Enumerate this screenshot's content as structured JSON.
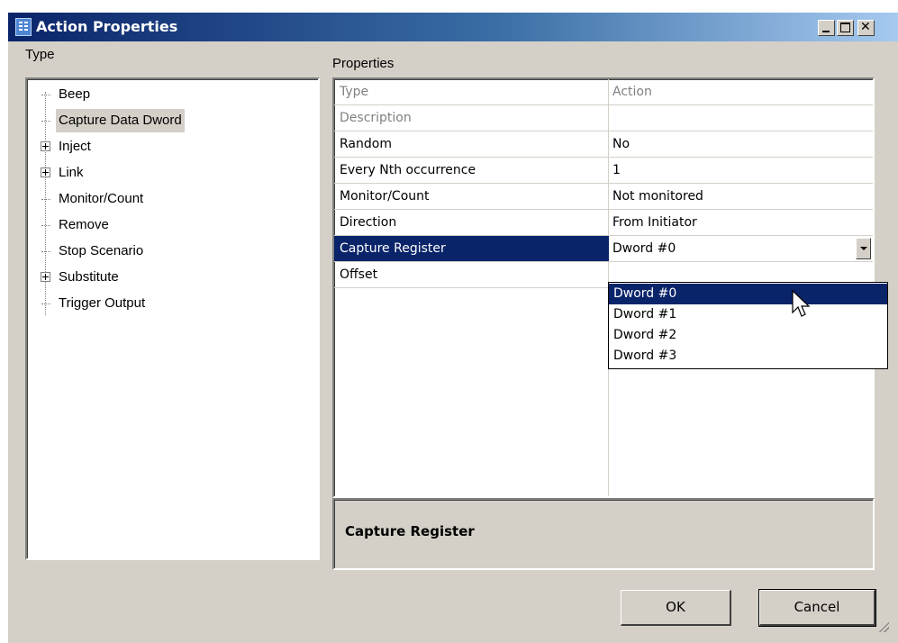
{
  "window": {
    "title": "Action Properties"
  },
  "type_panel": {
    "label": "Type",
    "items": [
      {
        "label": "Beep",
        "expandable": false,
        "selected": false
      },
      {
        "label": "Capture Data Dword",
        "expandable": false,
        "selected": true
      },
      {
        "label": "Inject",
        "expandable": true,
        "selected": false
      },
      {
        "label": "Link",
        "expandable": true,
        "selected": false
      },
      {
        "label": "Monitor/Count",
        "expandable": false,
        "selected": false
      },
      {
        "label": "Remove",
        "expandable": false,
        "selected": false
      },
      {
        "label": "Stop Scenario",
        "expandable": false,
        "selected": false
      },
      {
        "label": "Substitute",
        "expandable": true,
        "selected": false
      },
      {
        "label": "Trigger Output",
        "expandable": false,
        "selected": false
      }
    ]
  },
  "properties": {
    "label": "Properties",
    "rows": [
      {
        "name": "Type",
        "value": "Action",
        "disabled": true
      },
      {
        "name": "Description",
        "value": "",
        "disabled": true
      },
      {
        "name": "Random",
        "value": "No"
      },
      {
        "name": "Every Nth occurrence",
        "value": "1"
      },
      {
        "name": "Monitor/Count",
        "value": "Not monitored"
      },
      {
        "name": "Direction",
        "value": "From Initiator"
      },
      {
        "name": "Capture Register",
        "value": "Dword #0",
        "selected": true
      },
      {
        "name": "Offset",
        "value": ""
      }
    ],
    "dropdown_options": [
      "Dword #0",
      "Dword #1",
      "Dword #2",
      "Dword #3"
    ],
    "dropdown_selected": "Dword #0",
    "description_title": "Capture Register"
  },
  "buttons": {
    "ok": "OK",
    "cancel": "Cancel"
  },
  "colors": {
    "selection": "#0a246a",
    "window_bg": "#d4d0c8"
  }
}
